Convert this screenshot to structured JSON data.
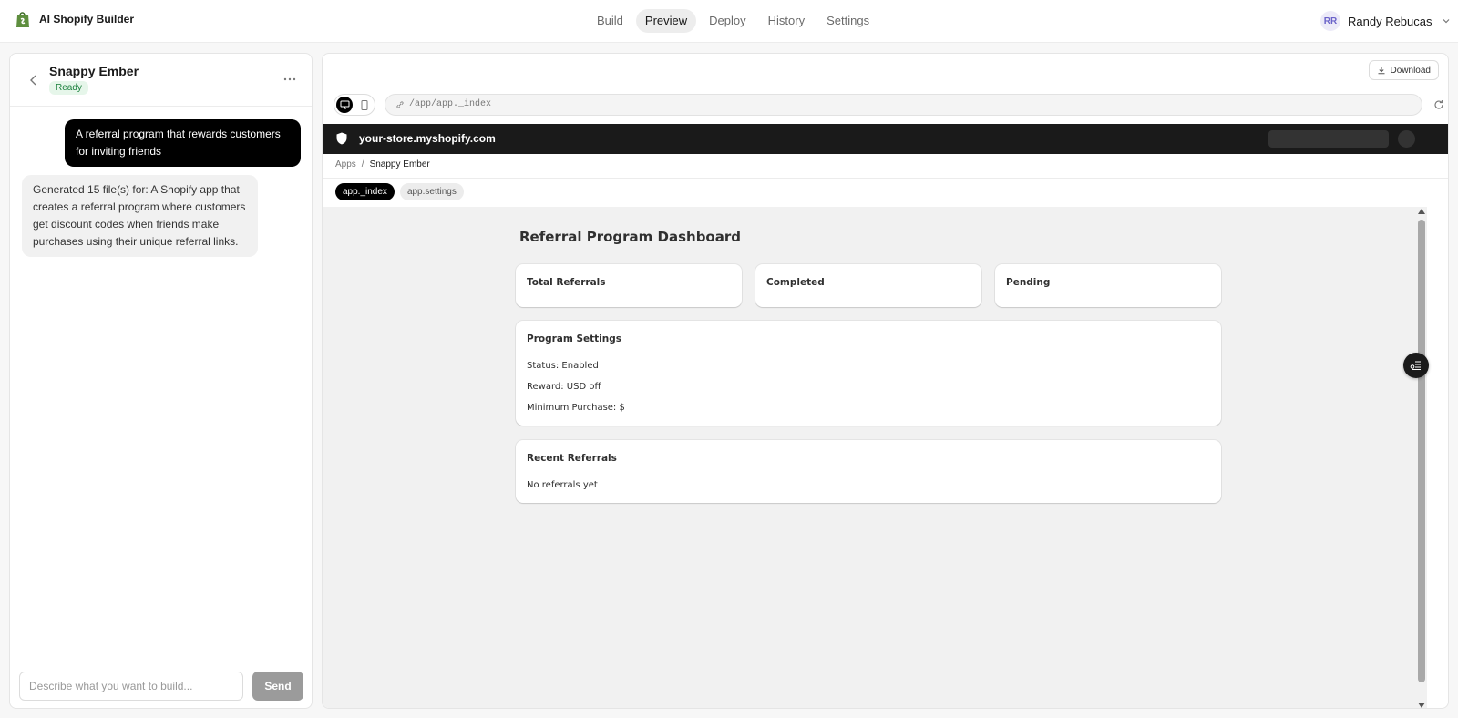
{
  "app": {
    "title": "AI Shopify Builder",
    "logo_icon": "shopify-bag-icon"
  },
  "nav": {
    "items": [
      {
        "label": "Build",
        "active": false
      },
      {
        "label": "Preview",
        "active": true
      },
      {
        "label": "Deploy",
        "active": false
      },
      {
        "label": "History",
        "active": false
      },
      {
        "label": "Settings",
        "active": false
      }
    ]
  },
  "user": {
    "initials": "RR",
    "name": "Randy Rebucas"
  },
  "chat": {
    "project_name": "Snappy Ember",
    "status": "Ready",
    "messages": [
      {
        "role": "user",
        "text": "A referral program that rewards customers for inviting friends"
      },
      {
        "role": "assistant",
        "text": "Generated 15 file(s) for: A Shopify app that creates a referral program where customers get discount codes when friends make purchases using their unique referral links."
      }
    ],
    "input_placeholder": "Describe what you want to build...",
    "send_label": "Send"
  },
  "preview": {
    "download_label": "Download",
    "url": "/app/app._index",
    "store_url": "your-store.myshopify.com",
    "breadcrumb": {
      "root": "Apps",
      "separator": "/",
      "current": "Snappy Ember"
    },
    "routes": [
      {
        "label": "app._index",
        "active": true
      },
      {
        "label": "app.settings",
        "active": false
      }
    ]
  },
  "dashboard": {
    "title": "Referral Program Dashboard",
    "stats": [
      {
        "label": "Total Referrals"
      },
      {
        "label": "Completed"
      },
      {
        "label": "Pending"
      }
    ],
    "settings": {
      "title": "Program Settings",
      "status": "Status: Enabled",
      "reward": "Reward: USD off",
      "minimum": "Minimum Purchase: $"
    },
    "recent": {
      "title": "Recent Referrals",
      "empty": "No referrals yet"
    }
  },
  "colors": {
    "accent": "#000000",
    "status_green": "#1a7f3c",
    "store_bar": "#1a1a1a"
  }
}
